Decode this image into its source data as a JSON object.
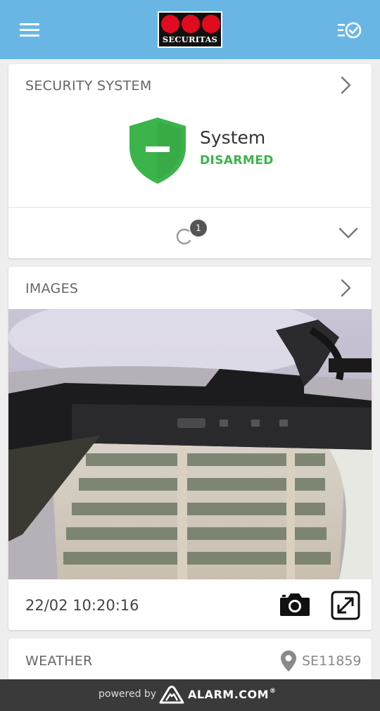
{
  "header": {
    "menu_icon": "hamburger-icon",
    "logo_text": "SECURITAS",
    "tasks_icon": "list-check-icon",
    "brand_color": "#69b6e5",
    "logo_red": "#e10b1f"
  },
  "security": {
    "title": "SECURITY SYSTEM",
    "system_label": "System",
    "status": "DISARMED",
    "status_color": "#3cb44b",
    "shield_icon": "shield-disarmed-icon",
    "sync_count": "1"
  },
  "images": {
    "title": "IMAGES",
    "timestamp": "22/02 10:20:16",
    "camera_icon": "camera-icon",
    "expand_icon": "expand-icon"
  },
  "weather": {
    "title": "WEATHER",
    "location": "SE11859",
    "location_icon": "location-pin-icon"
  },
  "footer": {
    "powered_by": "powered by",
    "brand": "ALARM.COM",
    "trademark": "®"
  }
}
